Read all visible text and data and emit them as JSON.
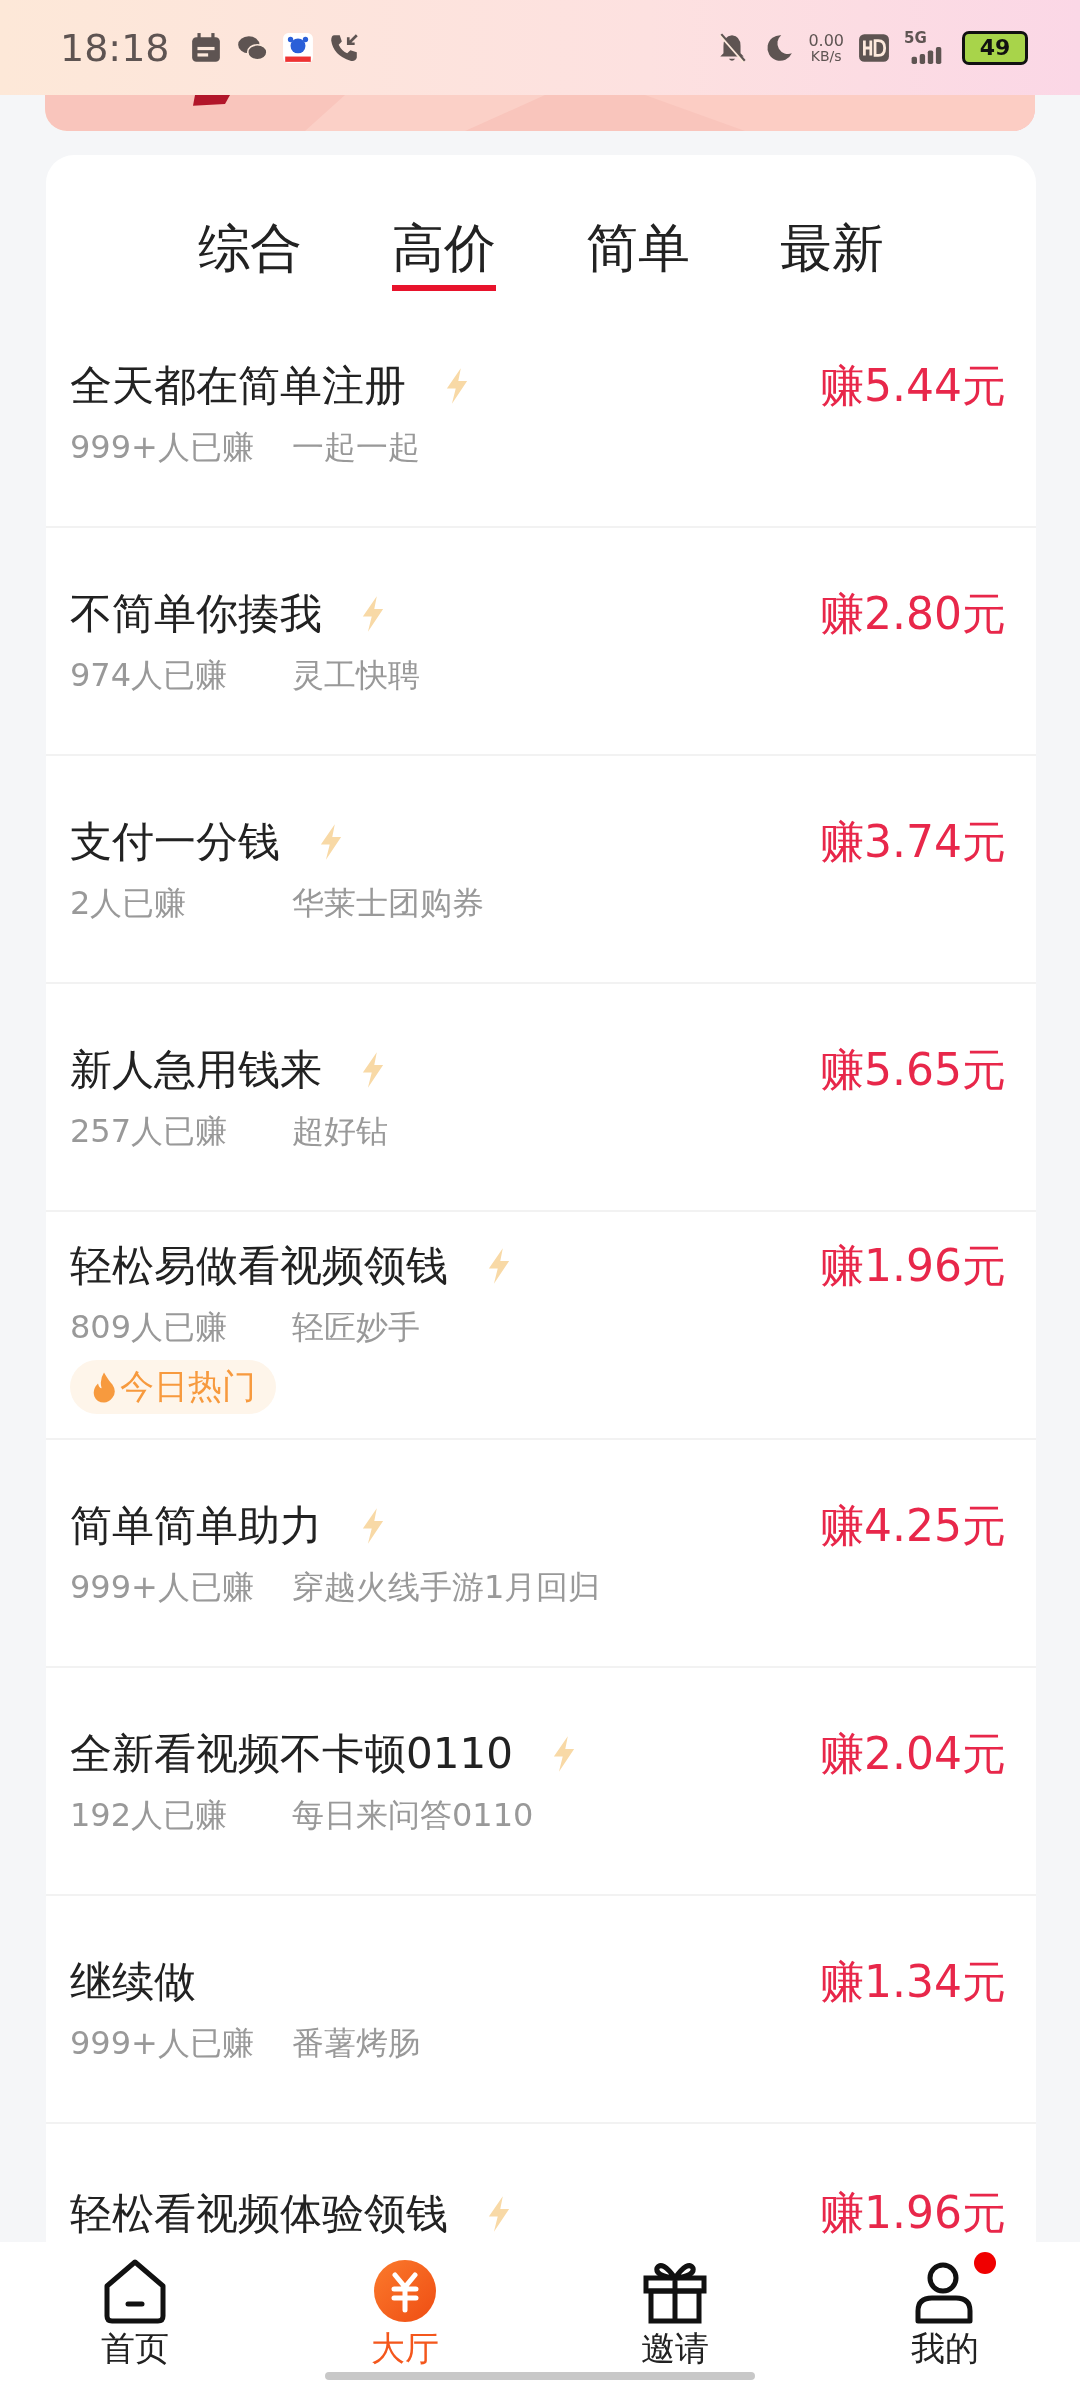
{
  "status_bar": {
    "time": "18:18",
    "net_speed": "0.00",
    "net_unit": "KB/s",
    "network": "5G",
    "battery": "49"
  },
  "tabs": [
    {
      "label": "综合",
      "selected": false
    },
    {
      "label": "高价",
      "selected": true
    },
    {
      "label": "简单",
      "selected": false
    },
    {
      "label": "最新",
      "selected": false
    }
  ],
  "tasks": [
    {
      "title": "全天都在简单注册",
      "flash": true,
      "earned": "999+人已赚",
      "merchant": "一起一起",
      "reward": "赚5.44元"
    },
    {
      "title": "不简单你揍我",
      "flash": true,
      "earned": "974人已赚",
      "merchant": "灵工快聘",
      "reward": "赚2.80元"
    },
    {
      "title": "支付一分钱",
      "flash": true,
      "earned": "2人已赚",
      "merchant": "华莱士团购券",
      "reward": "赚3.74元"
    },
    {
      "title": "新人急用钱来",
      "flash": true,
      "earned": "257人已赚",
      "merchant": "超好钻",
      "reward": "赚5.65元"
    },
    {
      "title": "轻松易做看视频领钱",
      "flash": true,
      "earned": "809人已赚",
      "merchant": "轻匠妙手",
      "reward": "赚1.96元",
      "tag": "今日热门"
    },
    {
      "title": "简单简单助力",
      "flash": true,
      "earned": "999+人已赚",
      "merchant": "穿越火线手游1月回归",
      "reward": "赚4.25元"
    },
    {
      "title": "全新看视频不卡顿0110",
      "flash": true,
      "earned": "192人已赚",
      "merchant": "每日来问答0110",
      "reward": "赚2.04元"
    },
    {
      "title": "继续做",
      "flash": false,
      "earned": "999+人已赚",
      "merchant": "番薯烤肠",
      "reward": "赚1.34元"
    },
    {
      "title": "轻松看视频体验领钱",
      "flash": true,
      "reward": "赚1.96元"
    }
  ],
  "bottom_nav": [
    {
      "label": "首页",
      "kind": "home",
      "selected": false,
      "badge": false
    },
    {
      "label": "大厅",
      "kind": "hall",
      "selected": true,
      "badge": false
    },
    {
      "label": "邀请",
      "kind": "gift",
      "selected": false,
      "badge": false
    },
    {
      "label": "我的",
      "kind": "user",
      "selected": false,
      "badge": true
    }
  ]
}
